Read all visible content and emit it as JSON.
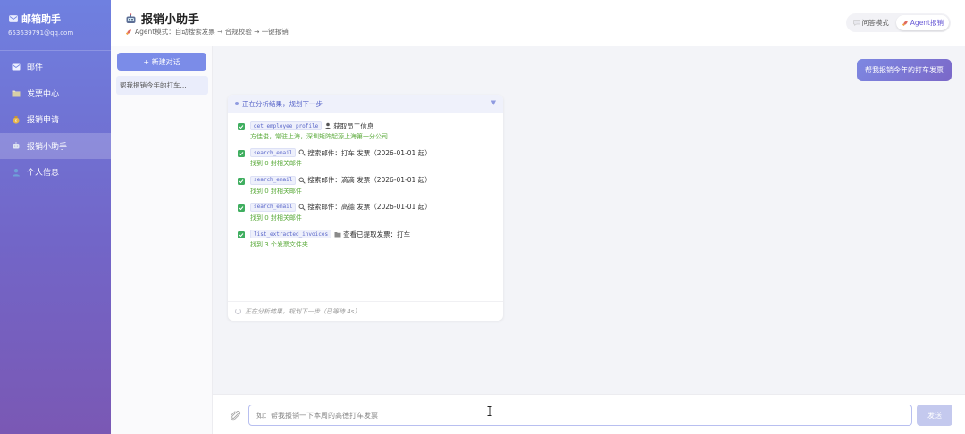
{
  "brand": {
    "title": "邮箱助手",
    "email": "653639791@qq.com"
  },
  "nav": [
    {
      "label": "邮件",
      "icon": "mail-icon",
      "active": false
    },
    {
      "label": "发票中心",
      "icon": "folder-icon",
      "active": false
    },
    {
      "label": "报销申请",
      "icon": "money-bag-icon",
      "active": false
    },
    {
      "label": "报销小助手",
      "icon": "robot-icon",
      "active": true
    },
    {
      "label": "个人信息",
      "icon": "user-icon",
      "active": false
    }
  ],
  "header": {
    "title": "报销小助手",
    "subtitle": "Agent模式：自动搜索发票 → 合规校验 → 一键报销",
    "modes": {
      "qa": "问答模式",
      "agent": "Agent报销"
    }
  },
  "conversations": {
    "new_label": "+ 新建对话",
    "items": [
      "帮我报销今年的打车..."
    ]
  },
  "chat": {
    "user_message": "帮我报销今年的打车发票",
    "agent_card": {
      "header": "正在分析结果，规划下一步",
      "steps": [
        {
          "tool": "get_employee_profile",
          "icon": "user-icon",
          "desc": "获取员工信息",
          "result": "方佳俊，常驻上海，深圳矩阵起源上海第一分公司"
        },
        {
          "tool": "search_email",
          "icon": "search-icon",
          "desc": "搜索邮件：打车 发票（2026-01-01 起）",
          "result": "找到 0 封相关邮件"
        },
        {
          "tool": "search_email",
          "icon": "search-icon",
          "desc": "搜索邮件：滴滴 发票（2026-01-01 起）",
          "result": "找到 0 封相关邮件"
        },
        {
          "tool": "search_email",
          "icon": "search-icon",
          "desc": "搜索邮件：高德 发票（2026-01-01 起）",
          "result": "找到 0 封相关邮件"
        },
        {
          "tool": "list_extracted_invoices",
          "icon": "folder-icon",
          "desc": "查看已提取发票：打车",
          "result": "找到 3 个发票文件夹"
        }
      ],
      "footer": "正在分析结果，规划下一步（已等待 4s）"
    }
  },
  "input": {
    "placeholder": "如：帮我报销一下本周的高德打车发票",
    "send_label": "发送"
  },
  "colors": {
    "accent": "#7b8ce8",
    "success": "#3fae5f",
    "result": "#5aaa3a"
  }
}
